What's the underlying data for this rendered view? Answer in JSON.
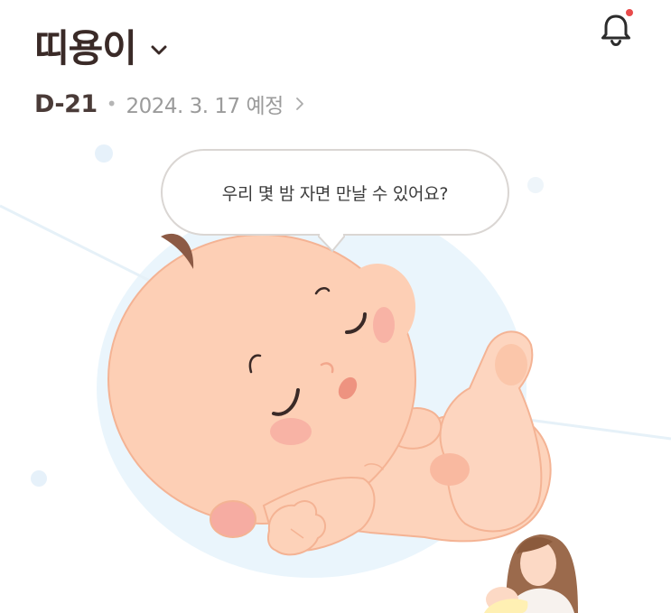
{
  "header": {
    "baby_name": "띠용이",
    "chevron_icon": "chevron-down-icon",
    "notification_icon": "bell-icon",
    "notification_dot_color": "#e84b4b"
  },
  "due": {
    "dday": "D-21",
    "separator": "•",
    "date_text": "2024. 3. 17 예정",
    "chevron_icon": "chevron-right-icon"
  },
  "illustration": {
    "speech_text": "우리 몇 밤 자면 만날 수 있어요?",
    "subject": "sleeping-baby",
    "corner_avatar": "mother-holding-baby"
  },
  "colors": {
    "title": "#3a2a27",
    "skin": "#fdcfb5",
    "blush": "#f6a9a0",
    "backdrop": "#eaf5fc"
  }
}
